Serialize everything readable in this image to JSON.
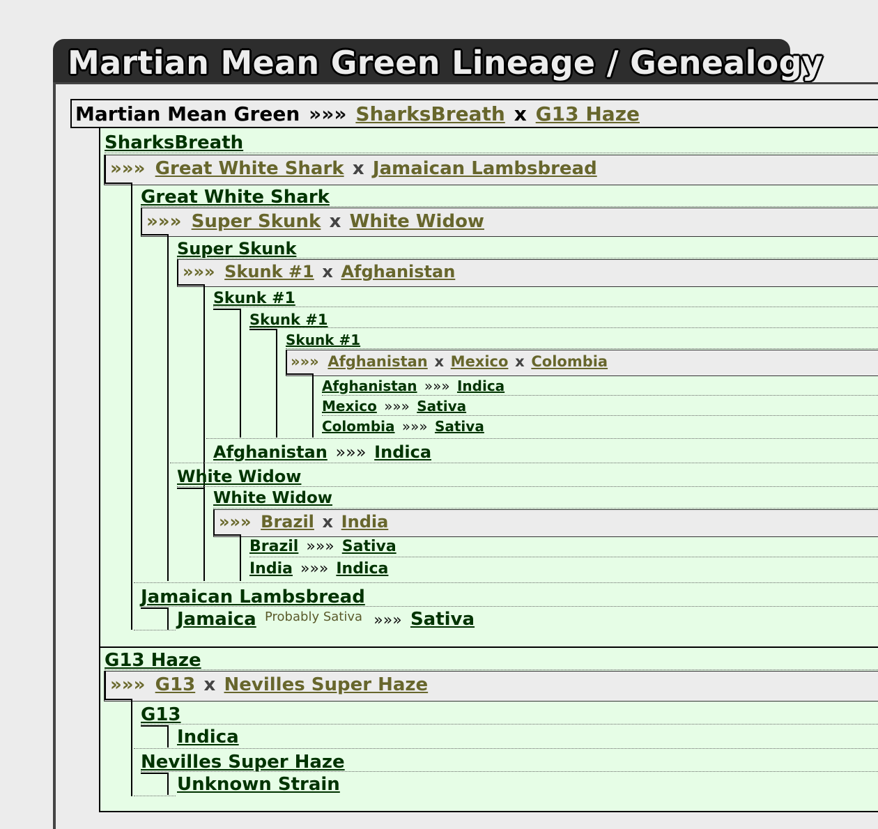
{
  "page": {
    "title": "Martian Mean Green Lineage / Genealogy"
  },
  "root": {
    "name": "Martian Mean Green",
    "arrow": "»»»",
    "parent1": "SharksBreath",
    "x": "x",
    "parent2": "G13 Haze"
  },
  "sharksbreath": {
    "name": "SharksBreath",
    "cross": {
      "arrow": "»»»",
      "p1": "Great White Shark",
      "x": "x",
      "p2": "Jamaican Lambsbread"
    },
    "gws": {
      "name": "Great White Shark",
      "cross": {
        "arrow": "»»»",
        "p1": "Super Skunk",
        "x": "x",
        "p2": "White Widow"
      },
      "super_skunk": {
        "name": "Super Skunk",
        "cross": {
          "arrow": "»»»",
          "p1": "Skunk #1",
          "x": "x",
          "p2": "Afghanistan"
        },
        "skunk1_a": "Skunk #1",
        "skunk1_b": "Skunk #1",
        "skunk1_c": "Skunk #1",
        "skunk_cross": {
          "arrow": "»»»",
          "p1": "Afghanistan",
          "x1": "x",
          "p2": "Mexico",
          "x2": "x",
          "p3": "Colombia"
        },
        "landraces": [
          {
            "name": "Afghanistan",
            "arrow": "»»»",
            "type": "Indica"
          },
          {
            "name": "Mexico",
            "arrow": "»»»",
            "type": "Sativa"
          },
          {
            "name": "Colombia",
            "arrow": "»»»",
            "type": "Sativa"
          }
        ],
        "afghanistan": {
          "name": "Afghanistan",
          "arrow": "»»»",
          "type": "Indica"
        }
      },
      "white_widow": {
        "name": "White Widow",
        "name2": "White Widow",
        "cross": {
          "arrow": "»»»",
          "p1": "Brazil",
          "x": "x",
          "p2": "India"
        },
        "landraces": [
          {
            "name": "Brazil",
            "arrow": "»»»",
            "type": "Sativa"
          },
          {
            "name": "India",
            "arrow": "»»»",
            "type": "Indica"
          }
        ]
      }
    },
    "jamaican": {
      "name": "Jamaican Lambsbread",
      "child": {
        "name": "Jamaica",
        "note": "Probably Sativa",
        "arrow": "»»»",
        "type": "Sativa"
      }
    }
  },
  "g13haze": {
    "name": "G13 Haze",
    "cross": {
      "arrow": "»»»",
      "p1": "G13",
      "x": "x",
      "p2": "Nevilles Super Haze"
    },
    "g13": {
      "name": "G13",
      "child": "Indica"
    },
    "nsh": {
      "name": "Nevilles Super Haze",
      "child": "Unknown Strain"
    }
  },
  "colors": {
    "link_dark": "#003300",
    "link_olive": "#67662c",
    "panel_green": "#e6fde6",
    "title_bg": "#2d2d2d"
  }
}
